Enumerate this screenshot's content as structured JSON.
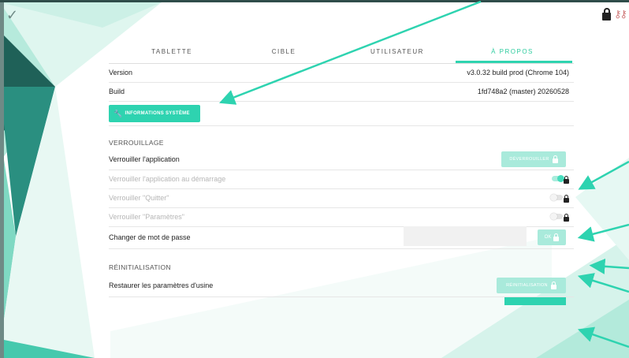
{
  "header": {
    "check_icon": "✓",
    "top_icons": [
      "lock-icon",
      "key-icon"
    ]
  },
  "tabs": [
    {
      "label": "TABLETTE",
      "active": false
    },
    {
      "label": "CIBLE",
      "active": false
    },
    {
      "label": "UTILISATEUR",
      "active": false
    },
    {
      "label": "À PROPOS",
      "active": true
    }
  ],
  "about": {
    "version_label": "Version",
    "version_value": "v3.0.32 build prod (Chrome 104)",
    "build_label": "Build",
    "build_value": "1fd748a2 (master) 20260528",
    "system_info_button": "INFORMATIONS SYSTÈME"
  },
  "lock_section": {
    "title": "VERROUILLAGE",
    "lock_app_label": "Verrouiller l'application",
    "unlock_button": "DÉVERROUILLER",
    "lock_on_start_label": "Verrouiller l'application au démarrage",
    "lock_quit_label": "Verrouiller \"Quitter\"",
    "lock_settings_label": "Verrouiller \"Paramètres\"",
    "change_password_label": "Changer de mot de passe",
    "ok_button": "OK"
  },
  "reset_section": {
    "title": "RÉINITIALISATION",
    "factory_reset_label": "Restaurer les paramètres d'usine",
    "reset_button": "RÉINITIALISATION"
  },
  "colors": {
    "accent": "#2ed3b0",
    "accent_light": "#a9eadb",
    "dark_polygon": "#1f5a52"
  }
}
